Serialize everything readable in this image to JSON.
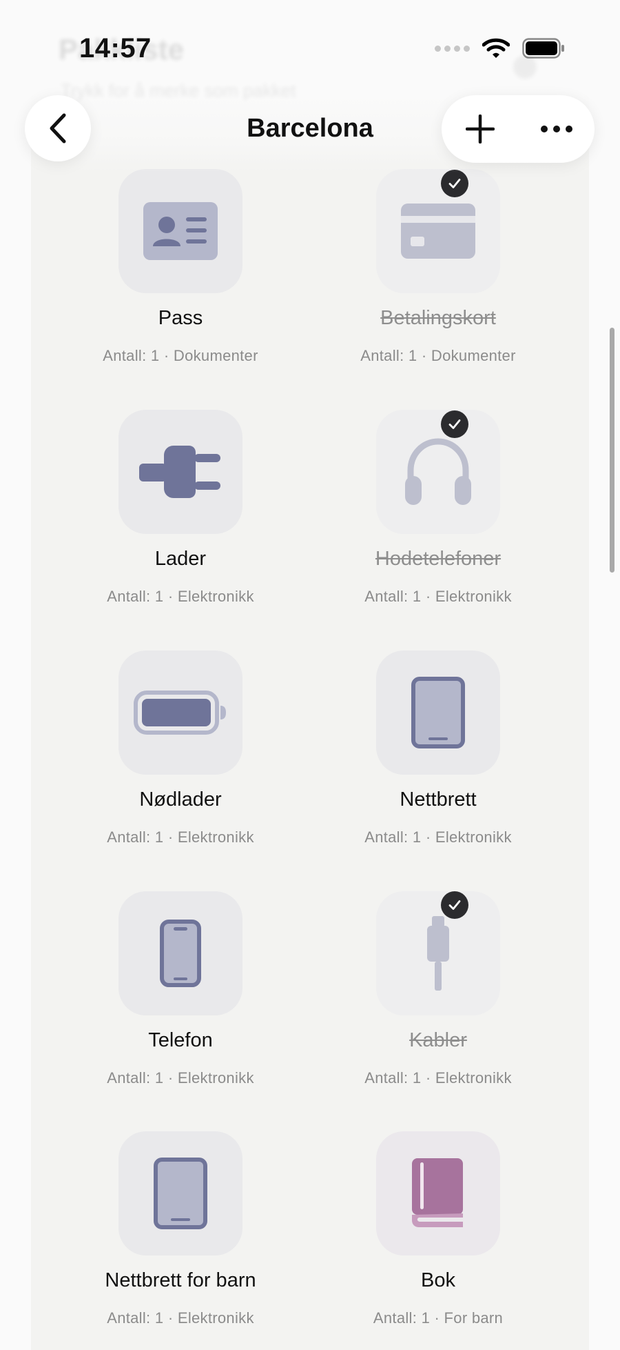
{
  "status_bar": {
    "time": "14:57"
  },
  "background_header": {
    "title": "Pakkliste",
    "subtitle": "Trykk for å merke som pakket"
  },
  "nav": {
    "title": "Barcelona"
  },
  "items": [
    {
      "name": "Pass",
      "meta": "Antall: 1 · Dokumenter",
      "icon": "id-card-icon",
      "packed": false
    },
    {
      "name": "Betalingskort",
      "meta": "Antall: 1 · Dokumenter",
      "icon": "credit-card-icon",
      "packed": true
    },
    {
      "name": "Lader",
      "meta": "Antall: 1 · Elektronikk",
      "icon": "plug-icon",
      "packed": false
    },
    {
      "name": "Hodetelefoner",
      "meta": "Antall: 1 · Elektronikk",
      "icon": "headphones-icon",
      "packed": true
    },
    {
      "name": "Nødlader",
      "meta": "Antall: 1 · Elektronikk",
      "icon": "battery-icon",
      "packed": false
    },
    {
      "name": "Nettbrett",
      "meta": "Antall: 1 · Elektronikk",
      "icon": "tablet-icon",
      "packed": false
    },
    {
      "name": "Telefon",
      "meta": "Antall: 1 · Elektronikk",
      "icon": "phone-icon",
      "packed": false
    },
    {
      "name": "Kabler",
      "meta": "Antall: 1 · Elektronikk",
      "icon": "cable-icon",
      "packed": true
    },
    {
      "name": "Nettbrett for barn",
      "meta": "Antall: 1 · Elektronikk",
      "icon": "tablet-icon",
      "packed": false
    },
    {
      "name": "Bok",
      "meta": "Antall: 1 · For barn",
      "icon": "book-icon",
      "packed": false
    }
  ],
  "colors": {
    "icon_primary": "#6f7499",
    "icon_secondary": "#b4b7cb",
    "book_primary": "#a7739d",
    "book_secondary": "#c79bbd",
    "check_badge": "#2b2b2e"
  }
}
